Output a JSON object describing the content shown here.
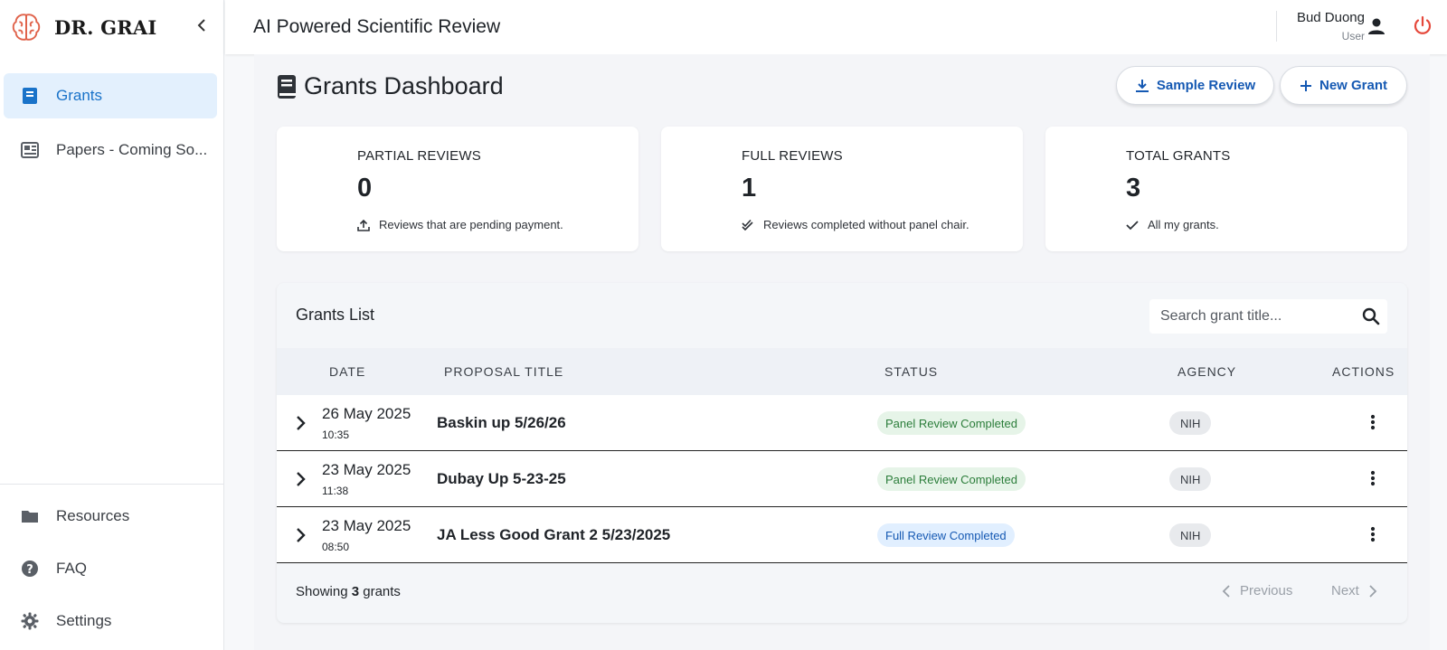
{
  "brand": {
    "name": "DR. GRAI"
  },
  "sidebar": {
    "items": [
      {
        "label": "Grants",
        "icon": "book-icon",
        "active": true
      },
      {
        "label": "Papers - Coming So...",
        "icon": "newspaper-icon",
        "active": false
      }
    ],
    "bottom_items": [
      {
        "label": "Resources",
        "icon": "folder-icon"
      },
      {
        "label": "FAQ",
        "icon": "question-circle-icon"
      },
      {
        "label": "Settings",
        "icon": "gear-icon"
      }
    ]
  },
  "header": {
    "title": "AI Powered Scientific Review",
    "user_name": "Bud Duong",
    "user_role": "User"
  },
  "page": {
    "title": "Grants Dashboard",
    "sample_review_label": "Sample Review",
    "new_grant_label": "New Grant"
  },
  "stats": [
    {
      "label": "PARTIAL REVIEWS",
      "value": "0",
      "desc": "Reviews that are pending payment.",
      "icon": "upload-icon"
    },
    {
      "label": "FULL REVIEWS",
      "value": "1",
      "desc": "Reviews completed without panel chair.",
      "icon": "double-check-icon"
    },
    {
      "label": "TOTAL GRANTS",
      "value": "3",
      "desc": "All my grants.",
      "icon": "check-icon"
    }
  ],
  "grants_list": {
    "title": "Grants List",
    "search_placeholder": "Search grant title...",
    "columns": [
      "DATE",
      "PROPOSAL TITLE",
      "STATUS",
      "AGENCY",
      "ACTIONS"
    ],
    "rows": [
      {
        "date": "26 May 2025",
        "time": "10:35",
        "title": "Baskin up 5/26/26",
        "status": "Panel Review Completed",
        "status_type": "panel",
        "agency": "NIH"
      },
      {
        "date": "23 May 2025",
        "time": "11:38",
        "title": "Dubay Up 5-23-25",
        "status": "Panel Review Completed",
        "status_type": "panel",
        "agency": "NIH"
      },
      {
        "date": "23 May 2025",
        "time": "08:50",
        "title": "JA Less Good Grant 2 5/23/2025",
        "status": "Full Review Completed",
        "status_type": "full",
        "agency": "NIH"
      }
    ],
    "showing_prefix": "Showing",
    "showing_count": "3",
    "showing_suffix": "grants",
    "previous_label": "Previous",
    "next_label": "Next"
  },
  "colors": {
    "accent": "#1a73c9",
    "brand_logo": "#e0624a",
    "power": "#e5483b",
    "panel_status": "#2b7d3a",
    "full_status": "#1559b3"
  }
}
